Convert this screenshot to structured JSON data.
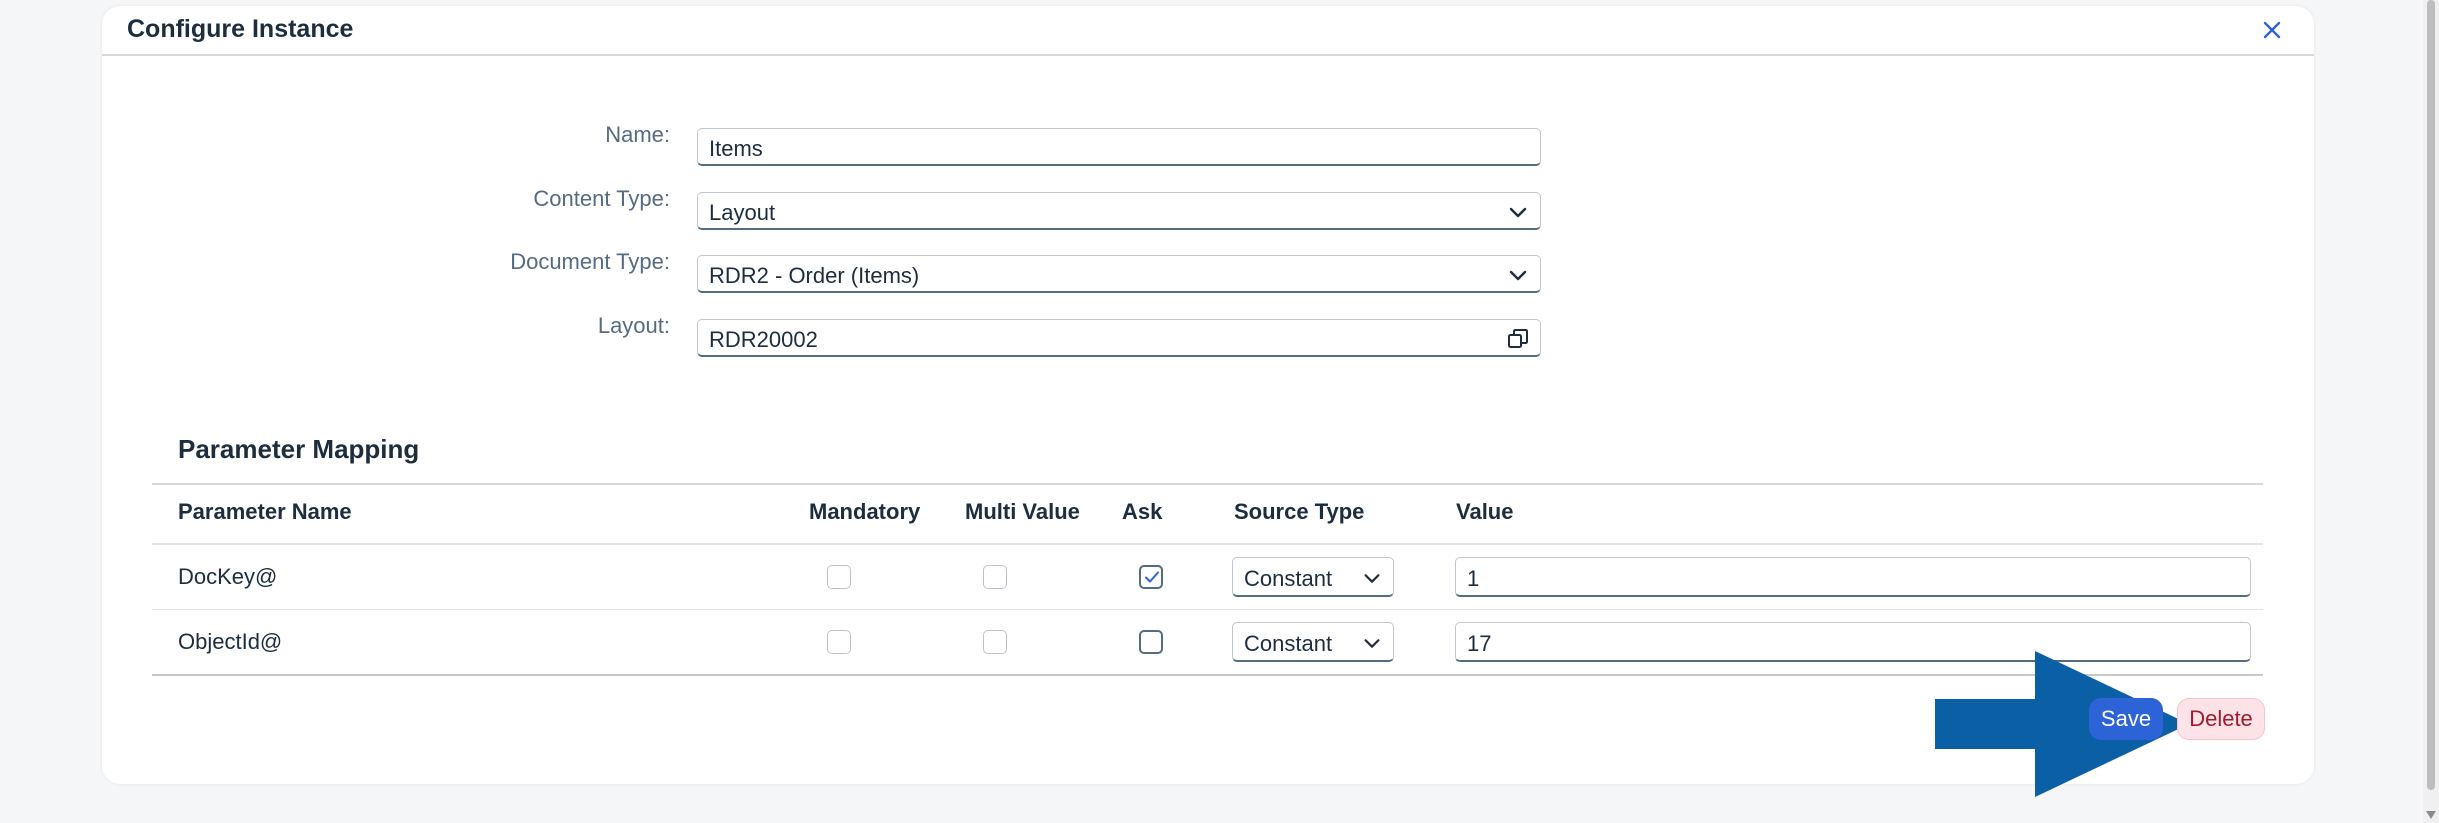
{
  "dialog": {
    "title": "Configure Instance",
    "close_icon": "close-icon"
  },
  "form": {
    "name_label": "Name:",
    "name_value": "Items",
    "content_type_label": "Content Type:",
    "content_type_value": "Layout",
    "document_type_label": "Document Type:",
    "document_type_value": "RDR2 - Order (Items)",
    "layout_label": "Layout:",
    "layout_value": "RDR20002"
  },
  "parameter_mapping": {
    "title": "Parameter Mapping",
    "columns": [
      "Parameter Name",
      "Mandatory",
      "Multi Value",
      "Ask",
      "Source Type",
      "Value"
    ],
    "rows": [
      {
        "name": "DocKey@",
        "mandatory": false,
        "multi_value": false,
        "ask": true,
        "source_type": "Constant",
        "value": "1"
      },
      {
        "name": "ObjectId@",
        "mandatory": false,
        "multi_value": false,
        "ask": false,
        "source_type": "Constant",
        "value": "17"
      }
    ]
  },
  "buttons": {
    "save": "Save",
    "delete": "Delete"
  },
  "colors": {
    "accent": "#2c64d8",
    "arrow": "#0b5fa5",
    "delete_bg": "#fde2e8",
    "delete_text": "#a01c2c"
  }
}
